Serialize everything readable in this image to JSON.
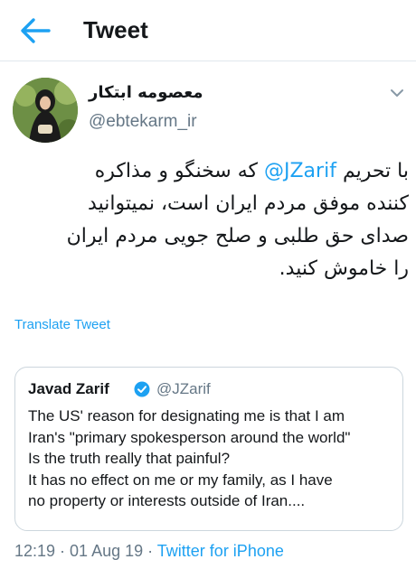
{
  "header": {
    "title": "Tweet",
    "back_icon": "arrow-left-icon",
    "accent": "#1da1f2"
  },
  "author": {
    "name": "معصومه ابتکار",
    "handle": "@ebtekarm_ir",
    "avatar_icon": "profile-photo",
    "menu_icon": "chevron-down-icon"
  },
  "tweet": {
    "line1_before": "با تحریم ",
    "mention": "@JZarif",
    "line1_after": " که سخنگو و مذاکره",
    "line2": "کننده موفق مردم ایران است، نمیتوانید",
    "line3": "صدای حق طلبی و صلح جویی مردم ایران",
    "line4": "را خاموش کنید."
  },
  "translate_label": "Translate Tweet",
  "quoted": {
    "name": "Javad Zarif",
    "verified_icon": "verified-badge-icon",
    "handle": "@JZarif",
    "lines": [
      "The US' reason for designating me is that I am",
      "Iran's \"primary spokesperson around the world\"",
      "Is the truth really that painful?",
      "It has no effect on me or my family, as I have",
      "no property or interests outside of Iran...."
    ]
  },
  "meta": {
    "prefix": "12:19 · 01 Aug 19 · ",
    "source": "Twitter for iPhone"
  }
}
